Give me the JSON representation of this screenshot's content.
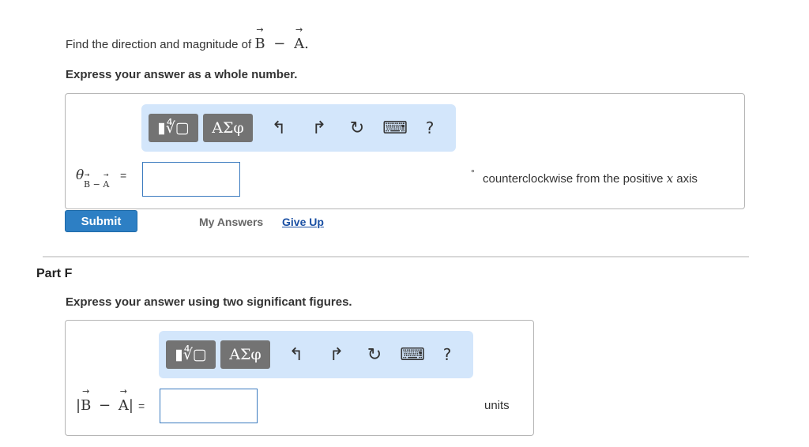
{
  "part_e": {
    "prompt_prefix": "Find the direction and magnitude of",
    "vec_b": "B",
    "minus": "−",
    "vec_a": "A",
    "prompt_suffix": ".",
    "instruction": "Express your answer as a whole number.",
    "answer_label_theta": "θ",
    "answer_label_sub_b": "B",
    "answer_label_sub_minus": "−",
    "answer_label_sub_a": "A",
    "answer_label_equals": "=",
    "input_value": "",
    "degree_symbol": "°",
    "unit_prefix": "counterclockwise from the positive",
    "unit_var": "x",
    "unit_suffix": "axis",
    "submit_label": "Submit",
    "my_answers_label": "My Answers",
    "give_up_label": "Give Up"
  },
  "part_f": {
    "header": "Part F",
    "instruction": "Express your answer using two significant figures.",
    "label_bar_open": "|",
    "vec_b": "B",
    "minus": "−",
    "vec_a": "A",
    "label_bar_close": "|",
    "label_equals": "=",
    "input_value": "",
    "units": "units"
  },
  "toolbar": {
    "templates_label": "▮∜▢",
    "greek_label": "ΑΣφ",
    "undo_icon": "↰",
    "redo_icon": "↱",
    "reset_icon": "↻",
    "keyboard_icon": "⌨",
    "help_label": "?"
  },
  "colors": {
    "accent": "#2d7fc4",
    "toolbar_bg": "#d3e6fb",
    "toolbar_btn": "#737373",
    "link": "#1a4fa3"
  }
}
